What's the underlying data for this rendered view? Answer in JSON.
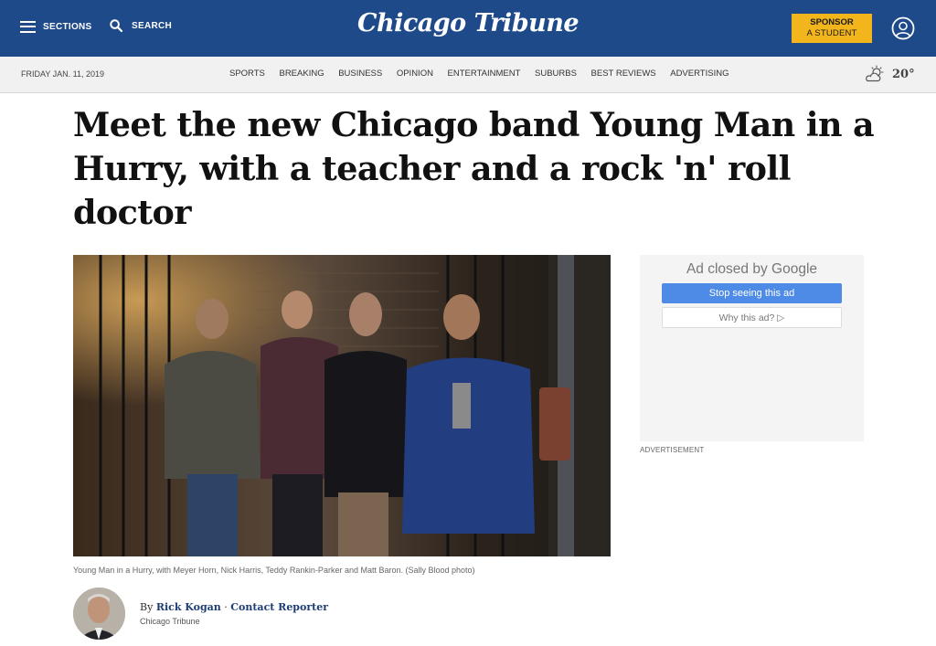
{
  "header": {
    "sections_label": "SECTIONS",
    "search_label": "SEARCH",
    "logo_text": "Chicago Tribune",
    "sponsor_line1": "SPONSOR",
    "sponsor_line2": "A STUDENT",
    "profile_icon": "user-circle-icon",
    "colors": {
      "bar": "#1e4a8a",
      "sponsor": "#f2b51c"
    }
  },
  "nav": {
    "date": "FRIDAY JAN. 11, 2019",
    "links": [
      "SPORTS",
      "BREAKING",
      "BUSINESS",
      "OPINION",
      "ENTERTAINMENT",
      "SUBURBS",
      "BEST REVIEWS",
      "ADVERTISING"
    ],
    "weather_icon": "partly-cloudy-icon",
    "temperature": "20°"
  },
  "article": {
    "headline": "Meet the new Chicago band Young Man in a Hurry, with a teacher and a rock 'n' roll doctor",
    "photo_caption": "Young Man in a Hurry, with Meyer Horn, Nick Harris, Teddy Rankin-Parker and Matt Baron. (Sally Blood photo)",
    "byline_prefix": "By",
    "author": "Rick Kogan",
    "separator": "·",
    "contact_label": "Contact Reporter",
    "publication": "Chicago Tribune"
  },
  "ad": {
    "closed_prefix": "Ad closed by",
    "closed_brand": "Google",
    "stop_label": "Stop seeing this ad",
    "why_label": "Why this ad? ▷",
    "advertisement_label": "ADVERTISEMENT",
    "colors": {
      "stop_button": "#4d8be6"
    }
  }
}
